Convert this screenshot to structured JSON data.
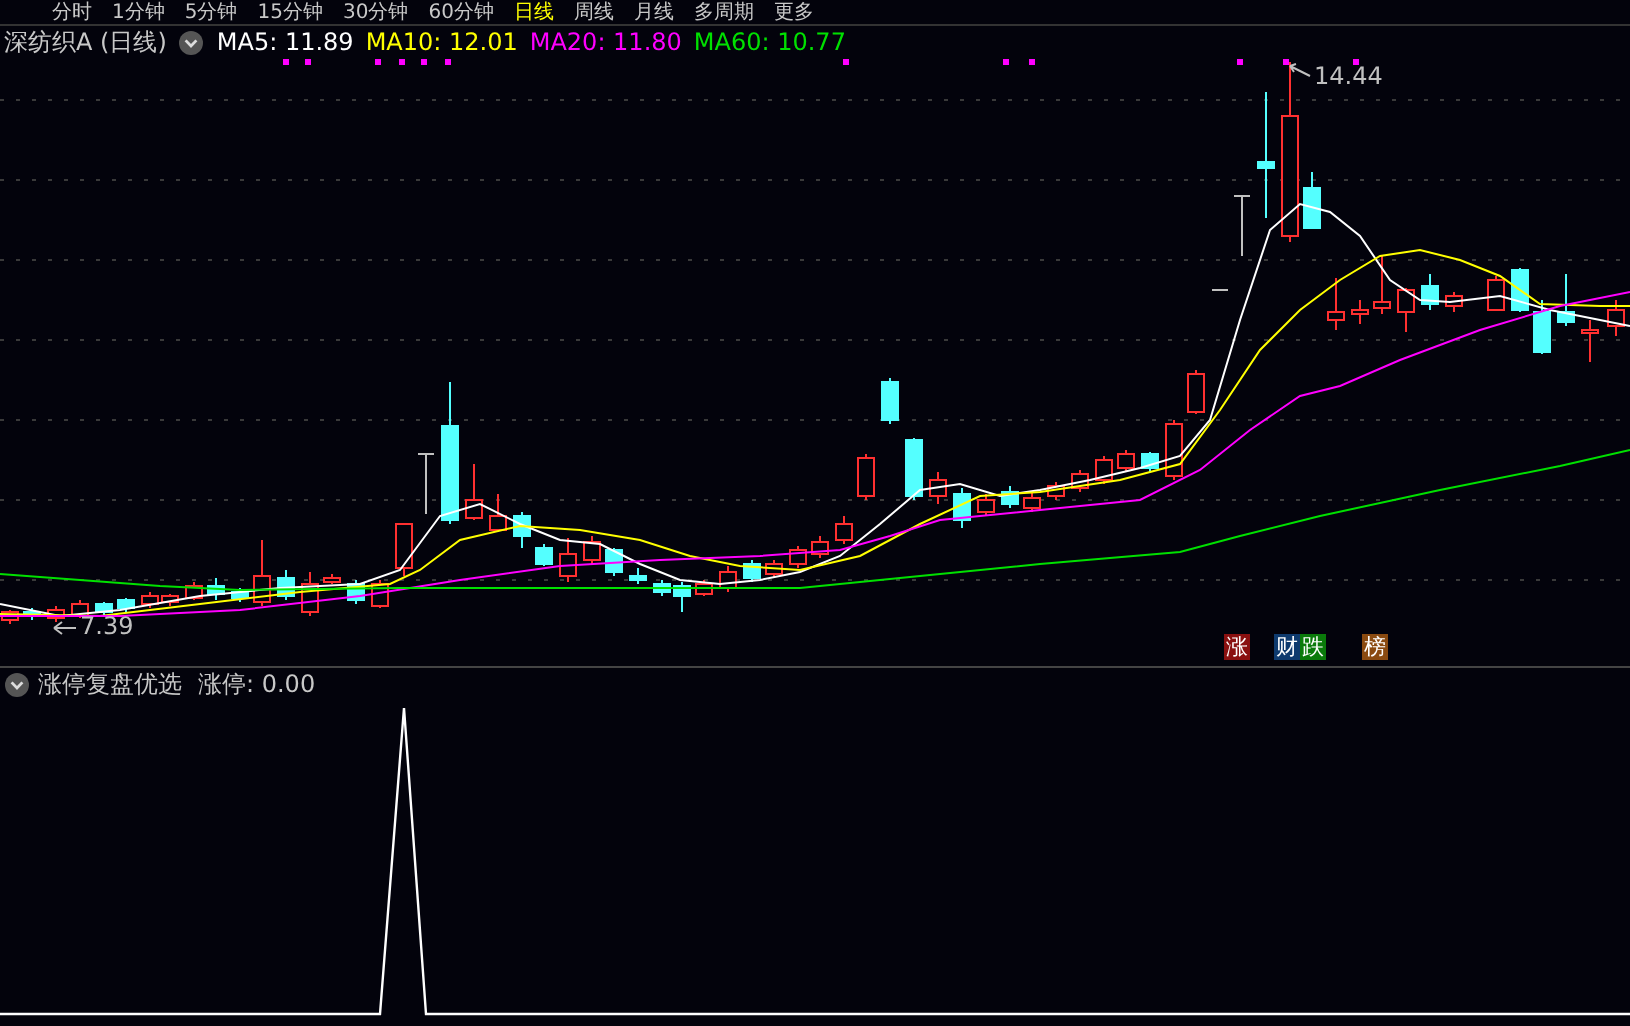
{
  "toolbar": {
    "tabs": [
      {
        "label": "分时",
        "selected": false
      },
      {
        "label": "1分钟",
        "selected": false
      },
      {
        "label": "5分钟",
        "selected": false
      },
      {
        "label": "15分钟",
        "selected": false
      },
      {
        "label": "30分钟",
        "selected": false
      },
      {
        "label": "60分钟",
        "selected": false
      },
      {
        "label": "日线",
        "selected": true
      },
      {
        "label": "周线",
        "selected": false
      },
      {
        "label": "月线",
        "selected": false
      },
      {
        "label": "多周期",
        "selected": false
      },
      {
        "label": "更多",
        "selected": false
      }
    ]
  },
  "main_chart": {
    "title": "深纺织A (日线)",
    "indicators": [
      {
        "label": "MA5: 11.89",
        "color": "#ffffff"
      },
      {
        "label": "MA10: 12.01",
        "color": "#ffff00"
      },
      {
        "label": "MA20: 11.80",
        "color": "#ff00ff"
      },
      {
        "label": "MA60: 10.77",
        "color": "#00e000"
      }
    ],
    "high_label": "14.44",
    "low_label": "7.39",
    "badges": [
      {
        "label": "涨",
        "color": "#8a1010"
      },
      {
        "label": "财",
        "color": "#0e3a6e"
      },
      {
        "label": "跌",
        "color": "#0a7a0a"
      },
      {
        "label": "榜",
        "color": "#8a4a10"
      }
    ]
  },
  "indicator_panel": {
    "title": "涨停复盘优选",
    "reading": "涨停: 0.00"
  }
}
